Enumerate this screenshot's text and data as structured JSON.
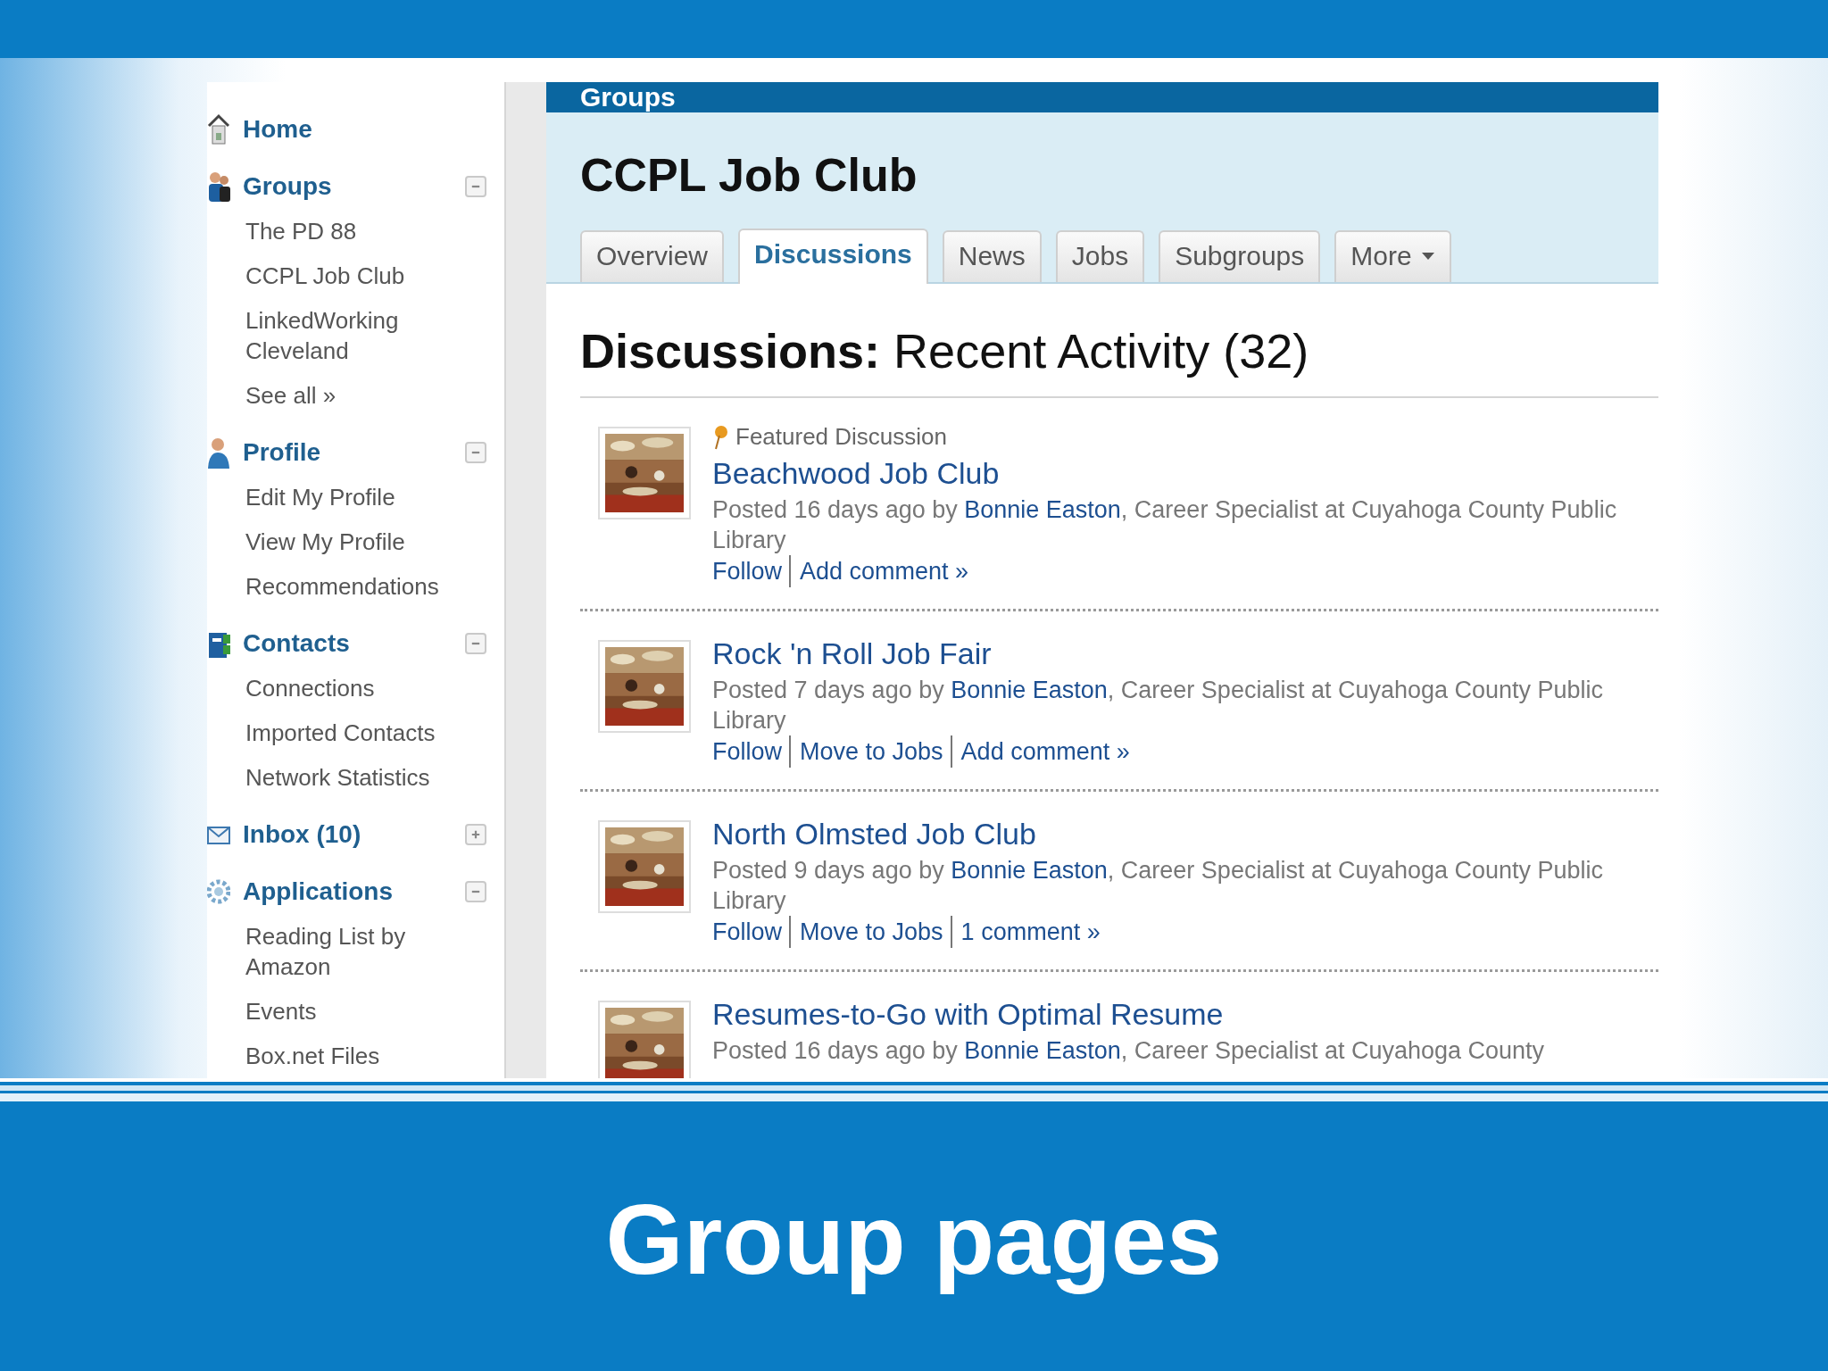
{
  "sidebar": [
    {
      "label": "Home"
    },
    {
      "label": "Groups",
      "expanded": true,
      "children": [
        "The PD 88",
        "CCPL Job Club",
        "LinkedWorking Cleveland",
        "See all »"
      ]
    },
    {
      "label": "Profile",
      "expanded": true,
      "children": [
        "Edit My Profile",
        "View My Profile",
        "Recommendations"
      ]
    },
    {
      "label": "Contacts",
      "expanded": true,
      "children": [
        "Connections",
        "Imported Contacts",
        "Network Statistics"
      ]
    },
    {
      "label": "Inbox (10)",
      "expanded": false
    },
    {
      "label": "Applications",
      "expanded": true,
      "children": [
        "Reading List by Amazon",
        "Events",
        "Box.net Files"
      ]
    }
  ],
  "header_bar": {
    "title": "Groups"
  },
  "group_title": "CCPL Job Club",
  "tabs": [
    {
      "label": "Overview",
      "selected": false
    },
    {
      "label": "Discussions",
      "selected": true
    },
    {
      "label": "News",
      "selected": false
    },
    {
      "label": "Jobs",
      "selected": false
    },
    {
      "label": "Subgroups",
      "selected": false
    },
    {
      "label": "More",
      "selected": false,
      "dropdown": true
    }
  ],
  "section_heading": {
    "bold": "Discussions:",
    "rest": "Recent Activity (32)"
  },
  "discussions": [
    {
      "featured": true,
      "featured_label": "Featured Discussion",
      "title": "Beachwood Job Club",
      "posted": "Posted 16 days ago by ",
      "author": "Bonnie Easton",
      "role": ", Career Specialist at Cuyahoga County Public Library",
      "actions": [
        "Follow",
        "Add comment »"
      ]
    },
    {
      "featured": false,
      "title": "Rock 'n Roll Job Fair",
      "posted": "Posted 7 days ago by ",
      "author": "Bonnie Easton",
      "role": ", Career Specialist at Cuyahoga County Public Library",
      "actions": [
        "Follow",
        "Move to Jobs",
        "Add comment »"
      ]
    },
    {
      "featured": false,
      "title": "North Olmsted Job Club",
      "posted": "Posted 9 days ago by ",
      "author": "Bonnie Easton",
      "role": ", Career Specialist at Cuyahoga County Public Library",
      "actions": [
        "Follow",
        "Move to Jobs",
        "1 comment »"
      ]
    },
    {
      "featured": false,
      "title": "Resumes-to-Go with Optimal Resume",
      "posted": "Posted 16 days ago by ",
      "author": "Bonnie Easton",
      "role": ", Career Specialist at Cuyahoga County"
    }
  ],
  "slide_title": "Group pages"
}
